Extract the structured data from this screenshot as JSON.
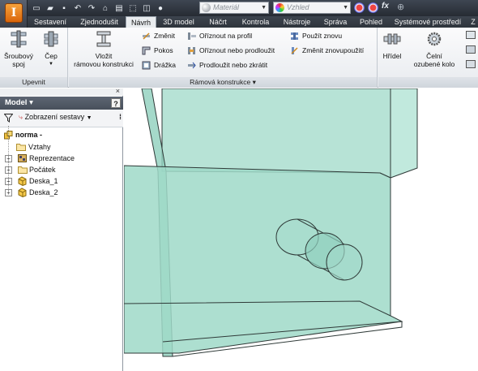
{
  "quick_access": {
    "material_placeholder": "Materiál",
    "appearance_placeholder": "Vzhled",
    "fx_label": "fx"
  },
  "tabs": [
    "Sestavení",
    "Zjednodušit",
    "Návrh",
    "3D model",
    "Náčrt",
    "Kontrola",
    "Nástroje",
    "Správa",
    "Pohled",
    "Systémové prostředí",
    "Z"
  ],
  "active_tab": "Návrh",
  "ribbon": {
    "upevnit": {
      "footer": "Upevnit",
      "bolt_line1": "Šroubový",
      "bolt_line2": "spoj",
      "pin_label": "Čep"
    },
    "frame": {
      "footer": "Rámová konstrukce ▾",
      "insert_line1": "Vložit",
      "insert_line2": "rámovou konstrukci",
      "change": "Změnit",
      "trim_profile": "Oříznout na profil",
      "reuse": "Použít znovu",
      "miter": "Pokos",
      "trim_extend": "Oříznout nebo prodloužit",
      "change_reuse": "Změnit znovupoužití",
      "notch": "Drážka",
      "lengthen": "Prodloužit nebo zkrátit"
    },
    "transmission": {
      "shaft": "Hřídel",
      "gear_line1": "Čelní",
      "gear_line2": "ozubené kolo"
    }
  },
  "browser": {
    "title": "Model ▾",
    "help": "?",
    "view_label": "Zobrazení sestavy",
    "tree": [
      {
        "label": "norma -",
        "bold": true
      },
      {
        "label": "Vztahy"
      },
      {
        "label": "Reprezentace"
      },
      {
        "label": "Počátek"
      },
      {
        "label": "Deska_1"
      },
      {
        "label": "Deska_2"
      }
    ]
  },
  "colors": {
    "titlebar": "#2f353e",
    "ribbon": "#eef0f3",
    "model_fill": "#9fd9c8",
    "model_edge": "#3a3a3a",
    "accent": "#e2872a"
  }
}
